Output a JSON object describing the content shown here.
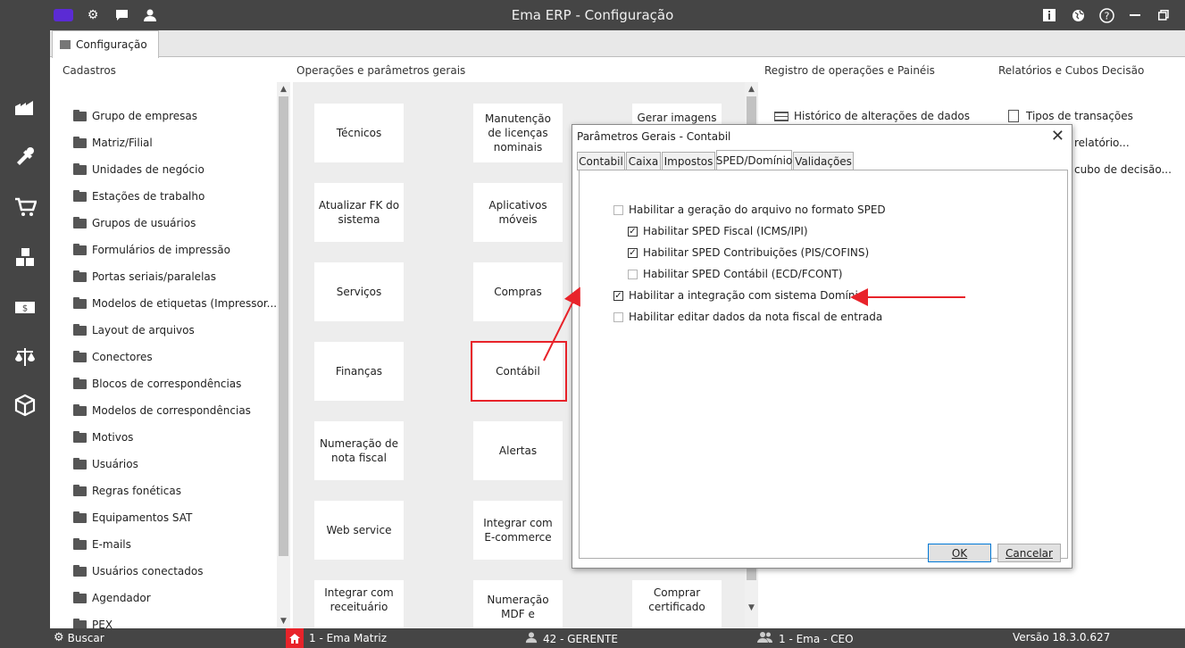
{
  "window": {
    "title": "Ema ERP - Configuração"
  },
  "tabs": {
    "active": "Configuração"
  },
  "sections": {
    "cadastros": "Cadastros",
    "operacoes": "Operações e parâmetros gerais",
    "registro": "Registro de operações e Painéis",
    "relatorios": "Relatórios e Cubos Decisão"
  },
  "cadastros": [
    "Grupo de empresas",
    "Matriz/Filial",
    "Unidades de negócio",
    "Estações de trabalho",
    "Grupos de usuários",
    "Formulários de impressão",
    "Portas seriais/paralelas",
    "Modelos de etiquetas (Impressor...",
    "Layout de arquivos",
    "Conectores",
    "Blocos de correspondências",
    "Modelos de correspondências",
    "Motivos",
    "Usuários",
    "Regras fonéticas",
    "Equipamentos SAT",
    "E-mails",
    "Usuários conectados",
    "Agendador",
    "PEX"
  ],
  "tiles": {
    "tecnicos": "Técnicos",
    "manutencao": "Manutenção de licenças nominais",
    "gerar_imagens": "Gerar imagens",
    "atualizar_fk": "Atualizar FK do sistema",
    "aplicativos": "Aplicativos móveis",
    "servicos": "Serviços",
    "compras": "Compras",
    "financas": "Finanças",
    "contabil": "Contábil",
    "numeracao_nf": "Numeração de nota fiscal",
    "alertas": "Alertas",
    "web_service": "Web service",
    "integrar_ecommerce": "Integrar com E-commerce",
    "integrar_receituario": "Integrar com receituário",
    "numeracao_mdf": "Numeração MDF e",
    "comprar_certificado": "Comprar certificado"
  },
  "registro": {
    "historico": "Histórico de alterações de dados"
  },
  "relatorios": {
    "tipos": "Tipos de transações",
    "relatorio": "relatório...",
    "cubo": "cubo de decisão..."
  },
  "dialog": {
    "title": "Parâmetros Gerais - Contabil",
    "tabs": [
      "Contabil",
      "Caixa",
      "Impostos",
      "SPED/Domínio",
      "Validações"
    ],
    "selected_tab": "SPED/Domínio",
    "options": [
      {
        "label": "Habilitar a geração do arquivo no formato SPED",
        "checked": false
      },
      {
        "label": "Habilitar SPED Fiscal (ICMS/IPI)",
        "checked": true
      },
      {
        "label": "Habilitar SPED Contribuições (PIS/COFINS)",
        "checked": true
      },
      {
        "label": "Habilitar SPED Contábil (ECD/FCONT)",
        "checked": false
      },
      {
        "label": "Habilitar a integração com sistema Domínio",
        "checked": true
      },
      {
        "label": "Habilitar editar dados da nota fiscal de entrada",
        "checked": false
      }
    ],
    "ok": "OK",
    "cancel": "Cancelar"
  },
  "status": {
    "buscar": "Buscar",
    "matriz": "1 - Ema Matriz",
    "gerente": "42 - GERENTE",
    "ceo": "1 - Ema - CEO",
    "versao": "Versão 18.3.0.627"
  },
  "colors": {
    "chrome": "#454545",
    "highlight": "#e8232a",
    "accent": "#5b2bd4"
  }
}
